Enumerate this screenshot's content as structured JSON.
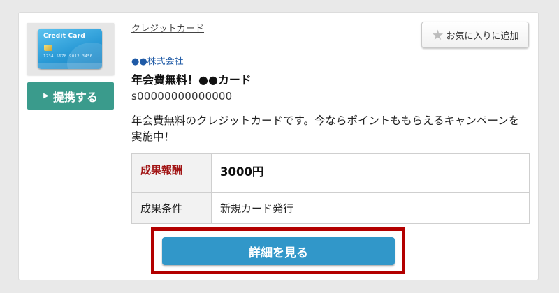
{
  "listing": {
    "thumbnail": {
      "card_title": "Credit Card",
      "card_number": "1234  5678  9012  3456",
      "icon": "credit-card-image"
    },
    "partner_button": {
      "label": "提携する",
      "icon": "play-triangle-icon"
    },
    "category": "クレジットカード",
    "favorite_button": {
      "label": "お気に入りに追加",
      "icon": "star-icon"
    },
    "company": "●●株式会社",
    "product_name": "年会費無料！●●カード",
    "code": "s00000000000000",
    "description": "年会費無料のクレジットカードです。今ならポイントももらえるキャンペーンを実施中！",
    "terms": [
      {
        "label": "成果報酬",
        "value": "3000円"
      },
      {
        "label": "成果条件",
        "value": "新規カード発行"
      }
    ],
    "detail_button": {
      "label": "詳細を見る"
    }
  },
  "colors": {
    "partner_button": "#3a9b8c",
    "detail_button": "#3197c9",
    "highlight_frame": "#b30000",
    "reward_label": "#a11414",
    "company_link": "#1f5aa6"
  }
}
